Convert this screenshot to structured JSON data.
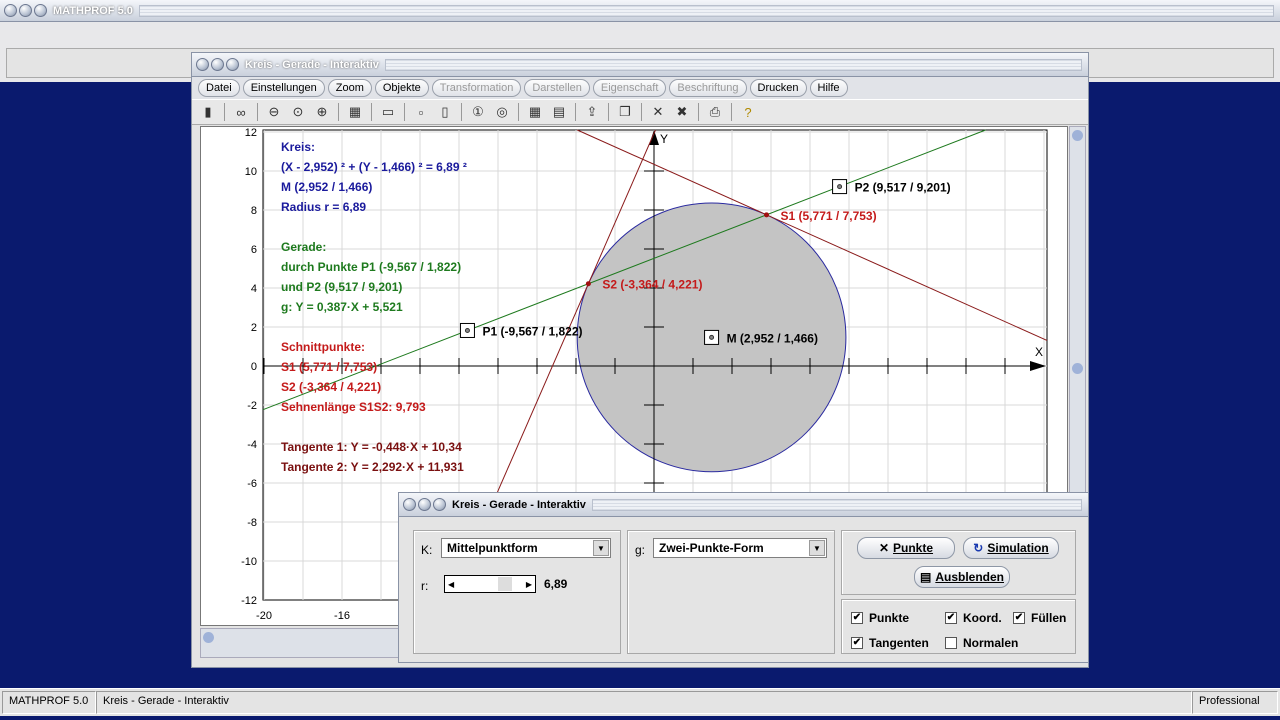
{
  "app": {
    "title": "MATHPROF 5.0"
  },
  "window": {
    "title": "Kreis - Gerade - Interaktiv"
  },
  "menu": [
    {
      "label": "Datei",
      "enabled": true
    },
    {
      "label": "Einstellungen",
      "enabled": true
    },
    {
      "label": "Zoom",
      "enabled": true
    },
    {
      "label": "Objekte",
      "enabled": true
    },
    {
      "label": "Transformation",
      "enabled": false
    },
    {
      "label": "Darstellen",
      "enabled": false
    },
    {
      "label": "Eigenschaft",
      "enabled": false
    },
    {
      "label": "Beschriftung",
      "enabled": false
    },
    {
      "label": "Drucken",
      "enabled": true
    },
    {
      "label": "Hilfe",
      "enabled": true
    }
  ],
  "toolbar": [
    "panel-icon",
    "glasses-icon",
    "zoom-out-icon",
    "zoom-reset-icon",
    "zoom-in-icon",
    "properties-icon",
    "window-icon",
    "frame-icon",
    "frames-icon",
    "circle-1-icon",
    "circle-2-icon",
    "table-icon",
    "document-icon",
    "export-icon",
    "copy-icon",
    "cross-icon",
    "double-cross-icon",
    "printer-icon",
    "help-icon"
  ],
  "info": {
    "kreis": [
      "Kreis:",
      "(X - 2,952) ² + (Y - 1,466) ² = 6,89 ²",
      "M (2,952 / 1,466)",
      "Radius r = 6,89"
    ],
    "gerade": [
      "Gerade:",
      "durch Punkte P1 (-9,567 / 1,822)",
      "und P2 (9,517 / 9,201)",
      "g: Y = 0,387·X + 5,521"
    ],
    "schnitt": [
      "Schnittpunkte:",
      "S1 (5,771 / 7,753)",
      "S2 (-3,364 / 4,221)",
      "Sehnenlänge S1S2: 9,793"
    ],
    "tangenten": [
      "Tangente 1: Y = -0,448·X + 10,34",
      "Tangente 2: Y = 2,292·X + 11,931"
    ]
  },
  "colors": {
    "blue": "#1a1a9c",
    "green": "#1e7a1e",
    "red": "#c41a1a",
    "darkred": "#7a1010",
    "circle_fill": "#c4c4c4",
    "circle_stroke": "#2a2aa0"
  },
  "chart_data": {
    "type": "line",
    "xlabel": "X",
    "ylabel": "Y",
    "xlim": [
      -20,
      20
    ],
    "ylim": [
      -12,
      12
    ],
    "grid": true,
    "y_ticks": [
      "12",
      "10",
      "8",
      "6",
      "4",
      "2",
      "0",
      "-2",
      "-4",
      "-6",
      "-8",
      "-10",
      "-12"
    ],
    "x_ticks": [
      "-20",
      "-16"
    ],
    "circle": {
      "cx": 2.952,
      "cy": 1.466,
      "r": 6.89
    },
    "lines": [
      {
        "m": 0.387,
        "b": 5.521,
        "color": "#1e7a1e"
      },
      {
        "m": -0.448,
        "b": 10.34,
        "color": "#8a1a1a"
      },
      {
        "m": 2.292,
        "b": 11.931,
        "color": "#8a1a1a"
      }
    ],
    "points": [
      {
        "label": "P1 (-9,567 / 1,822)",
        "x": -9.567,
        "y": 1.822,
        "kind": "square"
      },
      {
        "label": "P2 (9,517 / 9,201)",
        "x": 9.517,
        "y": 9.201,
        "kind": "square"
      },
      {
        "label": "M (2,952 / 1,466)",
        "x": 2.952,
        "y": 1.466,
        "kind": "square"
      },
      {
        "label": "S1 (5,771 / 7,753)",
        "x": 5.771,
        "y": 7.753,
        "kind": "dot"
      },
      {
        "label": "S2 (-3,364 / 4,221)",
        "x": -3.364,
        "y": 4.221,
        "kind": "dot"
      }
    ]
  },
  "dialog": {
    "title": "Kreis - Gerade - Interaktiv",
    "k_label": "K:",
    "k_value": "Mittelpunktform",
    "g_label": "g:",
    "g_value": "Zwei-Punkte-Form",
    "r_label": "r:",
    "r_value": "6,89",
    "btn_punkte": "Punkte",
    "btn_simulation": "Simulation",
    "btn_ausblenden": "Ausblenden",
    "checks": [
      {
        "label": "Punkte",
        "checked": true
      },
      {
        "label": "Koord.",
        "checked": true
      },
      {
        "label": "Füllen",
        "checked": true
      },
      {
        "label": "Tangenten",
        "checked": true
      },
      {
        "label": "Normalen",
        "checked": false
      }
    ]
  },
  "status": {
    "app": "MATHPROF 5.0",
    "doc": "Kreis - Gerade - Interaktiv",
    "edition": "Professional"
  }
}
